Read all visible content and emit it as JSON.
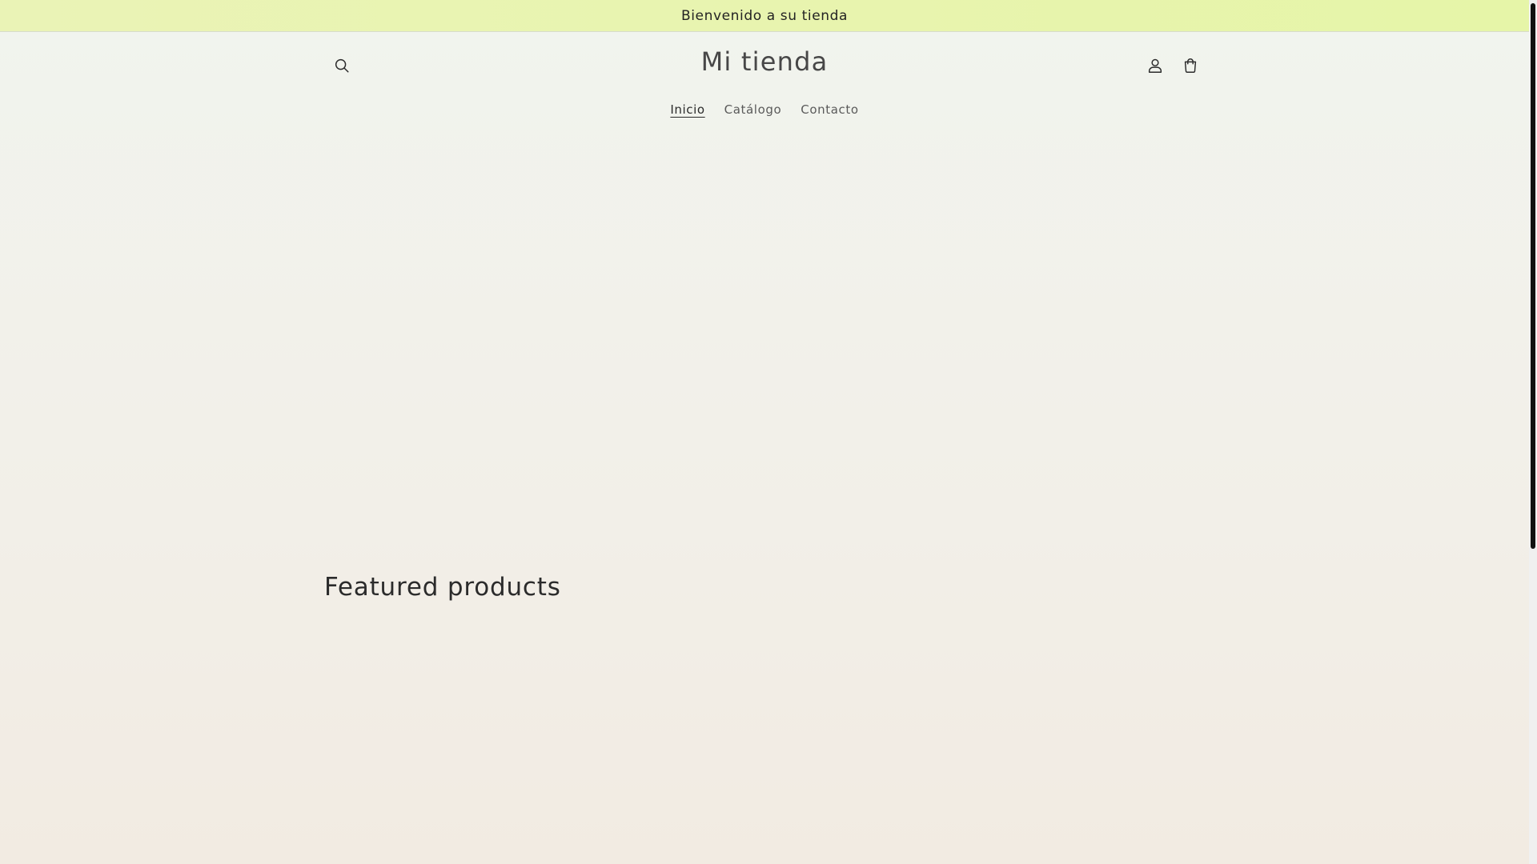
{
  "announcement": {
    "text": "Bienvenido a su tienda"
  },
  "header": {
    "logo": "Mi tienda",
    "icons": {
      "search": "search-icon",
      "account": "account-icon",
      "cart": "cart-icon"
    }
  },
  "nav": {
    "items": [
      {
        "label": "Inicio",
        "active": true
      },
      {
        "label": "Catálogo",
        "active": false
      },
      {
        "label": "Contacto",
        "active": false
      }
    ]
  },
  "featured": {
    "title": "Featured products"
  },
  "colors": {
    "announcement_bg": "#e8f4ae",
    "page_bg": "#f2f0e9",
    "text": "#2b2b2b",
    "scrollbar_thumb": "#111111"
  }
}
